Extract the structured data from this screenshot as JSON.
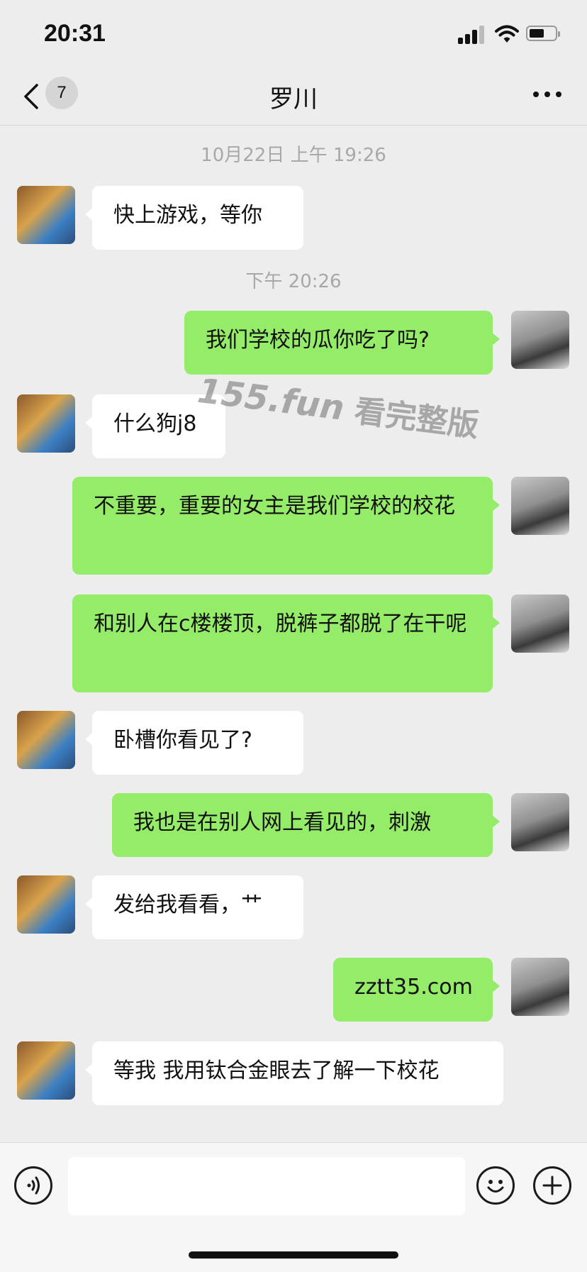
{
  "status_bar": {
    "time": "20:31"
  },
  "nav": {
    "unread_count": "7",
    "title": "罗川"
  },
  "messages": [
    {
      "type": "timestamp",
      "text": "10月22日 上午 19:26"
    },
    {
      "type": "message",
      "side": "left",
      "text": "快上游戏，等你"
    },
    {
      "type": "timestamp",
      "text": "下午 20:26"
    },
    {
      "type": "message",
      "side": "right",
      "text": "我们学校的瓜你吃了吗?"
    },
    {
      "type": "message",
      "side": "left",
      "text": "什么狗j8"
    },
    {
      "type": "message",
      "side": "right",
      "text": "不重要，重要的女主是我们学校的校花"
    },
    {
      "type": "message",
      "side": "right",
      "text": "和别人在c楼楼顶，脱裤子都脱了在干呢"
    },
    {
      "type": "message",
      "side": "left",
      "text": "卧槽你看见了?"
    },
    {
      "type": "message",
      "side": "right",
      "text": "我也是在别人网上看见的，刺激"
    },
    {
      "type": "message",
      "side": "left",
      "text": "发给我看看，艹"
    },
    {
      "type": "message",
      "side": "right",
      "text": "zztt35.com"
    },
    {
      "type": "message",
      "side": "left",
      "text": "等我 我用钛合金眼去了解一下校花"
    }
  ],
  "watermark": {
    "site": "155.fun",
    "text": "看完整版"
  },
  "input": {
    "value": ""
  },
  "icons": {
    "back": "chevron-left-icon",
    "more": "more-icon",
    "voice": "voice-icon",
    "emoji": "emoji-icon",
    "add": "plus-icon"
  }
}
